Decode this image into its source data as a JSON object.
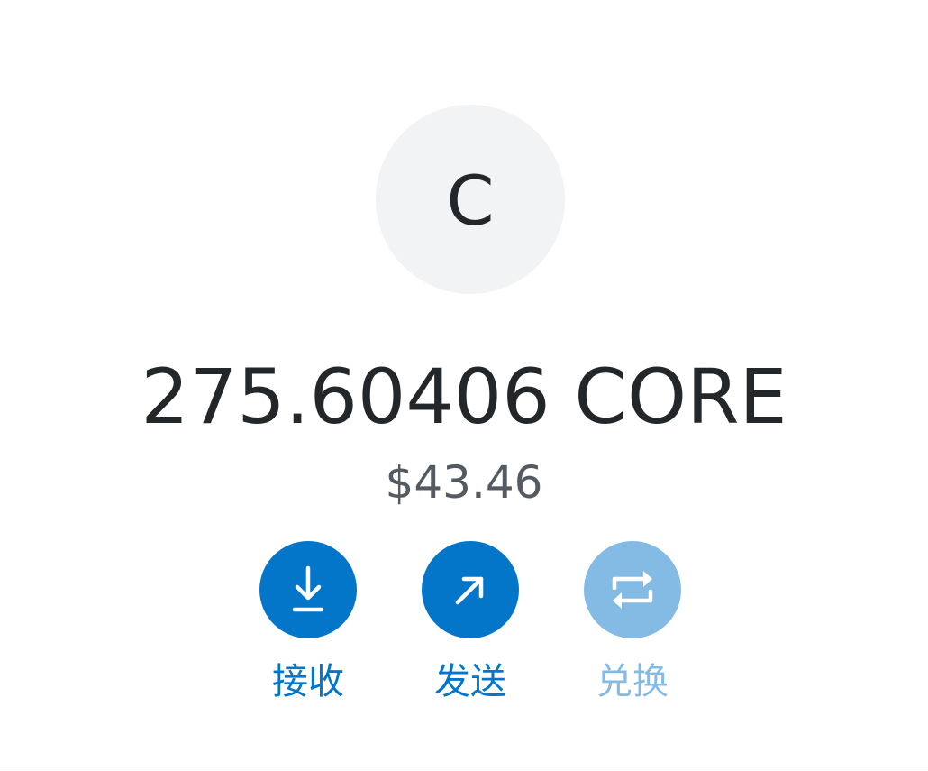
{
  "asset": {
    "avatar_letter": "C",
    "balance": "275.60406 CORE",
    "fiat_value": "$43.46"
  },
  "actions": [
    {
      "label": "接收",
      "icon": "download-icon",
      "enabled": true
    },
    {
      "label": "发送",
      "icon": "arrow-up-right-icon",
      "enabled": true
    },
    {
      "label": "兑换",
      "icon": "swap-icon",
      "enabled": false
    }
  ],
  "colors": {
    "primary": "#0376c9",
    "primary_disabled": "#84bbe4",
    "text_primary": "#24272a",
    "text_secondary": "#535a61",
    "avatar_bg": "#f2f3f5"
  }
}
